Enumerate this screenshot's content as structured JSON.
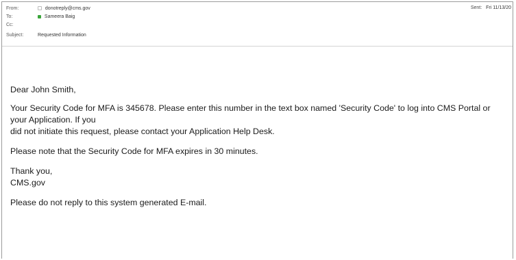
{
  "header": {
    "from_label": "From:",
    "from_value": "donotreply@cms.gov",
    "to_label": "To:",
    "to_value": "Sameera Baig",
    "cc_label": "Cc:",
    "cc_value": "",
    "subject_label": "Subject:",
    "subject_value": "Requested Information",
    "sent_label": "Sent:",
    "sent_value": "Fri 11/13/20"
  },
  "message": {
    "greeting": "Dear John Smith,",
    "para1_line1": "Your Security Code for MFA is 345678. Please enter this number in the text box named 'Security Code' to log into CMS Portal or your Application. If you",
    "para1_line2": "did not initiate this request, please contact your Application Help Desk.",
    "para2": "Please note that the Security Code for MFA expires in 30 minutes.",
    "closing1": "Thank you,",
    "closing2": "CMS.gov",
    "footer": "Please do not reply to this system generated E-mail."
  },
  "colors": {
    "presence_online": "#3aa53a",
    "border": "#9a9a9a"
  }
}
